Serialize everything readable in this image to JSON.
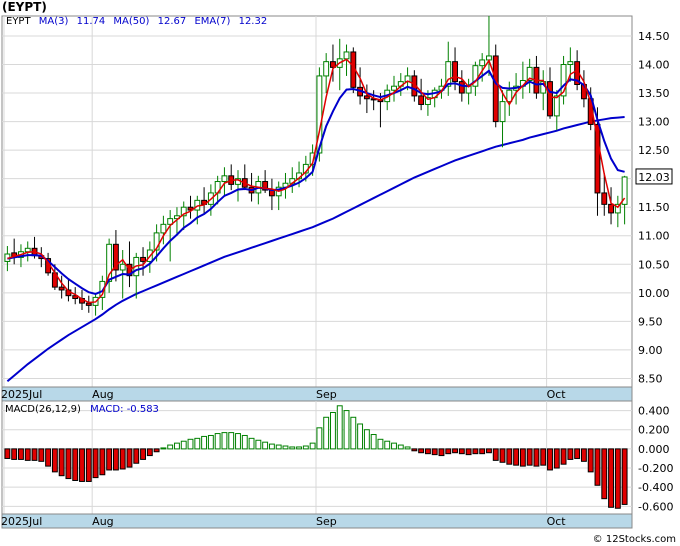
{
  "title": "(EYPT)",
  "credit": "© 12Stocks.com",
  "colors": {
    "up_candle": "#008000",
    "down_candle": "#e00000",
    "ma3": "#e00000",
    "ma50": "#0000cc",
    "ema7": "#0000cc",
    "macd_pos": "#008000",
    "macd_neg": "#e00000",
    "axis_band": "#b8d8e8",
    "grid": "#d8d8d8",
    "price_label_bg": "#ffffff"
  },
  "price_legend": {
    "symbol": "EYPT",
    "ma3_label": "MA(3)",
    "ma3_value": "11.74",
    "ma50_label": "MA(50)",
    "ma50_value": "12.67",
    "ema7_label": "EMA(7)",
    "ema7_value": "12.32"
  },
  "last_price_label": "12.03",
  "macd_legend": {
    "params": "MACD(26,12,9)",
    "label": "MACD:",
    "value": "-0.583"
  },
  "chart_data": [
    {
      "type": "candlestick",
      "name": "price",
      "ylim": [
        8.35,
        14.85
      ],
      "yticks": [
        "8.50",
        "9.00",
        "9.50",
        "10.00",
        "10.50",
        "11.00",
        "11.50",
        "12.00",
        "12.50",
        "13.00",
        "13.50",
        "14.00",
        "14.50"
      ],
      "xticks": [
        "2025Jul",
        "Aug",
        "Sep",
        "Oct"
      ],
      "xtick_index": [
        0,
        13,
        46,
        80
      ],
      "ohlc": [
        [
          10.55,
          10.82,
          10.38,
          10.68
        ],
        [
          10.7,
          10.95,
          10.5,
          10.62
        ],
        [
          10.62,
          10.85,
          10.45,
          10.72
        ],
        [
          10.72,
          10.9,
          10.55,
          10.78
        ],
        [
          10.78,
          10.98,
          10.6,
          10.65
        ],
        [
          10.65,
          10.8,
          10.45,
          10.6
        ],
        [
          10.6,
          10.7,
          10.3,
          10.35
        ],
        [
          10.35,
          10.5,
          10.05,
          10.1
        ],
        [
          10.1,
          10.3,
          9.9,
          10.05
        ],
        [
          10.05,
          10.25,
          9.85,
          9.95
        ],
        [
          9.95,
          10.1,
          9.8,
          9.9
        ],
        [
          9.9,
          10.05,
          9.7,
          9.82
        ],
        [
          9.82,
          9.95,
          9.65,
          9.78
        ],
        [
          9.78,
          9.98,
          9.6,
          9.92
        ],
        [
          9.92,
          10.3,
          9.7,
          10.2
        ],
        [
          10.2,
          10.95,
          10.0,
          10.85
        ],
        [
          10.85,
          11.1,
          10.2,
          10.4
        ],
        [
          10.4,
          10.75,
          9.9,
          10.5
        ],
        [
          10.5,
          10.9,
          10.1,
          10.3
        ],
        [
          10.3,
          10.7,
          9.9,
          10.62
        ],
        [
          10.62,
          10.8,
          10.3,
          10.55
        ],
        [
          10.55,
          10.9,
          10.35,
          10.75
        ],
        [
          10.75,
          11.2,
          10.55,
          11.05
        ],
        [
          11.05,
          11.35,
          10.85,
          11.2
        ],
        [
          11.2,
          11.45,
          10.55,
          11.3
        ],
        [
          11.3,
          11.5,
          11.0,
          11.35
        ],
        [
          11.35,
          11.6,
          11.1,
          11.5
        ],
        [
          11.5,
          11.7,
          11.3,
          11.45
        ],
        [
          11.45,
          11.7,
          11.2,
          11.62
        ],
        [
          11.62,
          11.85,
          11.4,
          11.55
        ],
        [
          11.55,
          11.9,
          11.35,
          11.75
        ],
        [
          11.75,
          12.05,
          11.55,
          11.95
        ],
        [
          11.95,
          12.2,
          11.7,
          12.05
        ],
        [
          12.05,
          12.25,
          11.8,
          11.9
        ],
        [
          11.9,
          12.15,
          11.6,
          12.0
        ],
        [
          12.0,
          12.25,
          11.8,
          11.85
        ],
        [
          11.85,
          12.1,
          11.6,
          11.75
        ],
        [
          11.75,
          12.05,
          11.55,
          11.95
        ],
        [
          11.95,
          12.15,
          11.75,
          11.8
        ],
        [
          11.8,
          12.0,
          11.45,
          11.7
        ],
        [
          11.7,
          11.95,
          11.45,
          11.85
        ],
        [
          11.85,
          12.1,
          11.65,
          11.92
        ],
        [
          11.92,
          12.2,
          11.75,
          12.0
        ],
        [
          12.0,
          12.3,
          11.85,
          12.1
        ],
        [
          12.1,
          12.4,
          11.95,
          12.25
        ],
        [
          12.25,
          12.6,
          12.05,
          12.45
        ],
        [
          12.45,
          13.95,
          12.3,
          13.8
        ],
        [
          13.8,
          14.2,
          13.5,
          14.05
        ],
        [
          14.05,
          14.35,
          13.7,
          13.95
        ],
        [
          13.95,
          14.45,
          13.55,
          14.1
        ],
        [
          14.1,
          14.35,
          13.8,
          14.22
        ],
        [
          14.22,
          14.3,
          13.5,
          13.6
        ],
        [
          13.6,
          13.95,
          13.3,
          13.45
        ],
        [
          13.45,
          13.65,
          13.15,
          13.4
        ],
        [
          13.4,
          13.55,
          13.2,
          13.38
        ],
        [
          13.38,
          13.5,
          12.9,
          13.35
        ],
        [
          13.35,
          13.65,
          13.2,
          13.55
        ],
        [
          13.55,
          13.8,
          13.35,
          13.62
        ],
        [
          13.62,
          13.85,
          13.45,
          13.7
        ],
        [
          13.7,
          13.95,
          13.55,
          13.8
        ],
        [
          13.8,
          13.9,
          13.35,
          13.45
        ],
        [
          13.45,
          13.75,
          13.2,
          13.3
        ],
        [
          13.3,
          13.55,
          13.1,
          13.42
        ],
        [
          13.42,
          13.6,
          13.25,
          13.55
        ],
        [
          13.55,
          13.75,
          13.4,
          13.62
        ],
        [
          13.62,
          14.4,
          13.45,
          14.05
        ],
        [
          14.05,
          14.3,
          13.55,
          13.7
        ],
        [
          13.7,
          13.9,
          13.35,
          13.5
        ],
        [
          13.5,
          13.75,
          13.3,
          13.62
        ],
        [
          13.62,
          14.05,
          13.45,
          13.98
        ],
        [
          13.98,
          14.2,
          13.7,
          14.08
        ],
        [
          14.08,
          14.85,
          13.8,
          14.15
        ],
        [
          14.15,
          14.35,
          12.9,
          13.0
        ],
        [
          13.0,
          13.55,
          12.55,
          13.35
        ],
        [
          13.35,
          13.7,
          13.1,
          13.55
        ],
        [
          13.55,
          13.85,
          13.3,
          13.62
        ],
        [
          13.62,
          14.05,
          13.4,
          13.72
        ],
        [
          13.72,
          14.1,
          13.5,
          13.95
        ],
        [
          13.95,
          14.15,
          13.4,
          13.5
        ],
        [
          13.5,
          13.9,
          13.2,
          13.7
        ],
        [
          13.7,
          13.95,
          13.05,
          13.1
        ],
        [
          13.1,
          13.55,
          12.85,
          13.45
        ],
        [
          13.45,
          14.15,
          13.3,
          14.0
        ],
        [
          14.0,
          14.3,
          13.7,
          14.05
        ],
        [
          14.05,
          14.25,
          13.55,
          13.65
        ],
        [
          13.65,
          13.9,
          13.25,
          13.4
        ],
        [
          13.4,
          13.6,
          12.85,
          12.95
        ],
        [
          12.95,
          13.25,
          11.35,
          11.75
        ],
        [
          11.75,
          12.1,
          11.35,
          11.55
        ],
        [
          11.55,
          11.85,
          11.2,
          11.4
        ],
        [
          11.4,
          11.7,
          11.15,
          11.55
        ],
        [
          11.55,
          12.05,
          11.2,
          12.03
        ]
      ],
      "ma50": [
        8.45,
        8.55,
        8.65,
        8.75,
        8.84,
        8.93,
        9.02,
        9.1,
        9.18,
        9.26,
        9.33,
        9.4,
        9.47,
        9.54,
        9.62,
        9.71,
        9.79,
        9.86,
        9.92,
        9.98,
        10.03,
        10.08,
        10.13,
        10.18,
        10.23,
        10.28,
        10.33,
        10.38,
        10.43,
        10.48,
        10.53,
        10.58,
        10.63,
        10.67,
        10.71,
        10.75,
        10.79,
        10.83,
        10.87,
        10.91,
        10.95,
        10.99,
        11.03,
        11.07,
        11.11,
        11.15,
        11.2,
        11.25,
        11.3,
        11.36,
        11.42,
        11.48,
        11.54,
        11.6,
        11.66,
        11.72,
        11.78,
        11.84,
        11.9,
        11.96,
        12.02,
        12.07,
        12.12,
        12.17,
        12.22,
        12.27,
        12.32,
        12.36,
        12.4,
        12.44,
        12.48,
        12.52,
        12.56,
        12.59,
        12.62,
        12.65,
        12.68,
        12.72,
        12.75,
        12.78,
        12.81,
        12.84,
        12.88,
        12.91,
        12.94,
        12.97,
        13.0,
        13.02,
        13.04,
        13.06,
        13.07,
        13.08
      ],
      "ema7_overlay": [
        10.6,
        10.62,
        10.64,
        10.66,
        10.66,
        10.65,
        10.56,
        10.45,
        10.34,
        10.24,
        10.16,
        10.08,
        10.01,
        9.98,
        10.03,
        10.23,
        10.28,
        10.33,
        10.32,
        10.4,
        10.43,
        10.51,
        10.64,
        10.78,
        10.91,
        11.02,
        11.14,
        11.22,
        11.32,
        11.38,
        11.47,
        11.59,
        11.7,
        11.75,
        11.81,
        11.82,
        11.8,
        11.84,
        11.83,
        11.8,
        11.81,
        11.84,
        11.88,
        11.93,
        12.01,
        12.12,
        12.54,
        12.92,
        13.18,
        13.41,
        13.56,
        13.57,
        13.54,
        13.5,
        13.46,
        13.43,
        13.46,
        13.5,
        13.55,
        13.61,
        13.57,
        13.5,
        13.48,
        13.5,
        13.53,
        13.66,
        13.67,
        13.63,
        13.62,
        13.71,
        13.8,
        13.89,
        13.67,
        13.59,
        13.58,
        13.59,
        13.62,
        13.7,
        13.65,
        13.66,
        13.52,
        13.5,
        13.63,
        13.74,
        13.72,
        13.64,
        13.46,
        13.03,
        12.66,
        12.35,
        12.15,
        12.12
      ],
      "ma3": [
        10.6,
        10.64,
        10.67,
        10.71,
        10.72,
        10.68,
        10.53,
        10.35,
        10.17,
        10.03,
        9.97,
        9.89,
        9.83,
        9.84,
        9.97,
        10.32,
        10.48,
        10.58,
        10.4,
        10.47,
        10.49,
        10.64,
        10.78,
        11.0,
        11.18,
        11.28,
        11.38,
        11.43,
        11.52,
        11.54,
        11.64,
        11.75,
        11.92,
        11.97,
        11.98,
        11.92,
        11.87,
        11.85,
        11.83,
        11.82,
        11.78,
        11.82,
        11.92,
        12.01,
        12.12,
        12.27,
        12.83,
        13.43,
        13.93,
        14.03,
        14.09,
        13.97,
        13.76,
        13.48,
        13.41,
        13.38,
        13.43,
        13.51,
        13.62,
        13.71,
        13.66,
        13.52,
        13.39,
        13.42,
        13.53,
        13.74,
        13.79,
        13.75,
        13.61,
        13.7,
        13.89,
        14.07,
        13.74,
        13.5,
        13.3,
        13.51,
        13.63,
        13.76,
        13.72,
        13.72,
        13.43,
        13.42,
        13.52,
        13.83,
        13.9,
        13.7,
        13.33,
        12.7,
        12.08,
        11.57,
        11.5,
        11.66
      ]
    },
    {
      "type": "bar",
      "name": "macd_histogram",
      "ylim": [
        -0.68,
        0.5
      ],
      "yticks": [
        "0.400",
        "0.200",
        "0.000",
        "-0.200",
        "-0.400",
        "-0.600"
      ],
      "values": [
        -0.1,
        -0.11,
        -0.11,
        -0.12,
        -0.12,
        -0.13,
        -0.18,
        -0.24,
        -0.28,
        -0.31,
        -0.33,
        -0.34,
        -0.34,
        -0.3,
        -0.27,
        -0.22,
        -0.22,
        -0.21,
        -0.19,
        -0.15,
        -0.11,
        -0.07,
        -0.03,
        0.01,
        0.04,
        0.06,
        0.08,
        0.1,
        0.11,
        0.13,
        0.14,
        0.16,
        0.17,
        0.17,
        0.16,
        0.14,
        0.11,
        0.09,
        0.07,
        0.05,
        0.04,
        0.03,
        0.02,
        0.02,
        0.03,
        0.06,
        0.22,
        0.33,
        0.38,
        0.45,
        0.4,
        0.33,
        0.26,
        0.2,
        0.15,
        0.1,
        0.08,
        0.06,
        0.04,
        0.02,
        -0.02,
        -0.04,
        -0.05,
        -0.06,
        -0.07,
        -0.05,
        -0.04,
        -0.05,
        -0.06,
        -0.05,
        -0.05,
        -0.04,
        -0.12,
        -0.14,
        -0.16,
        -0.17,
        -0.18,
        -0.17,
        -0.18,
        -0.17,
        -0.22,
        -0.2,
        -0.16,
        -0.11,
        -0.1,
        -0.13,
        -0.24,
        -0.38,
        -0.52,
        -0.61,
        -0.62,
        -0.58
      ]
    }
  ]
}
